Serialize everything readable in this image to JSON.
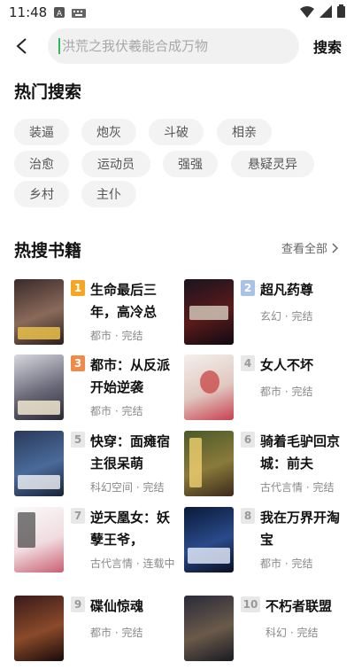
{
  "status": {
    "time": "11:48"
  },
  "search": {
    "placeholder": "洪荒之我伏羲能合成万物",
    "button": "搜索"
  },
  "hot_search": {
    "title": "热门搜索",
    "tags": [
      "装逼",
      "炮灰",
      "斗破",
      "相亲",
      "治愈",
      "运动员",
      "强强",
      "悬疑灵异",
      "乡村",
      "主仆"
    ]
  },
  "hot_books": {
    "title": "热搜书籍",
    "more": "查看全部",
    "items": [
      {
        "rank": "1",
        "title": "生命最后三年，高冷总",
        "meta": "都市 · 完结"
      },
      {
        "rank": "2",
        "title": "超凡药尊",
        "meta": "玄幻 · 完结"
      },
      {
        "rank": "3",
        "title": "都市：从反派开始逆袭",
        "meta": "都市 · 完结"
      },
      {
        "rank": "4",
        "title": "女人不坏",
        "meta": "都市 · 完结"
      },
      {
        "rank": "5",
        "title": "快穿：面瘫宿主很呆萌",
        "meta": "科幻空间 · 完结"
      },
      {
        "rank": "6",
        "title": "骑着毛驴回京城：前夫",
        "meta": "古代言情 · 完结"
      },
      {
        "rank": "7",
        "title": "逆天凰女：妖孽王爷，",
        "meta": "古代言情 · 连载中"
      },
      {
        "rank": "8",
        "title": "我在万界开淘宝",
        "meta": "都市 · 完结"
      },
      {
        "rank": "9",
        "title": "碟仙惊魂",
        "meta": "都市 · 完结"
      },
      {
        "rank": "10",
        "title": "不朽者联盟",
        "meta": "科幻 · 完结"
      }
    ]
  },
  "colors": {
    "rank_top": "#f5a623",
    "rank_second": "#a9c3e8",
    "rank_third": "#f08a4b",
    "rank_other": "#e8e8e8"
  }
}
